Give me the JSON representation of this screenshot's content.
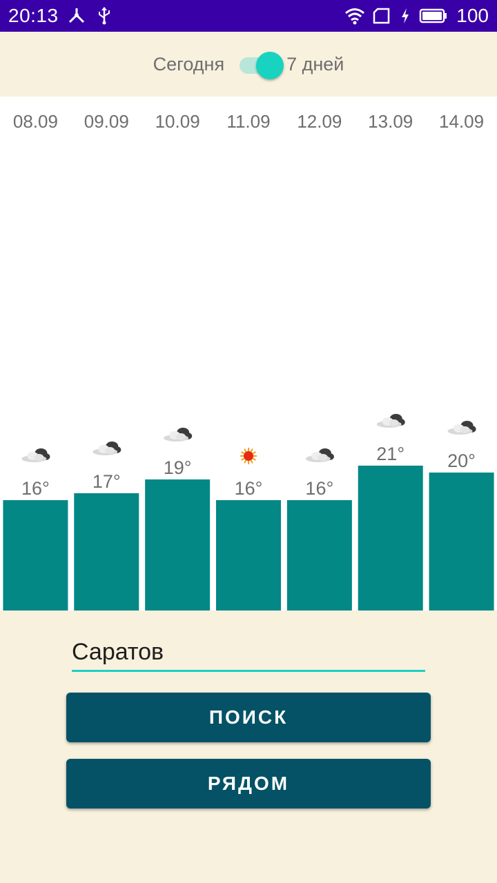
{
  "status_bar": {
    "time": "20:13",
    "battery": "100",
    "icons": [
      "network-share-icon",
      "usb-icon",
      "wifi-icon",
      "sim-card-icon",
      "charging-icon",
      "battery-icon"
    ]
  },
  "toggle": {
    "left_label": "Сегодня",
    "right_label": "7 дней",
    "state": "7 дней",
    "accent_color": "#18d3c0"
  },
  "chart_data": {
    "type": "bar",
    "categories": [
      "08.09",
      "09.09",
      "10.09",
      "11.09",
      "12.09",
      "13.09",
      "14.09"
    ],
    "values": [
      16,
      17,
      19,
      16,
      16,
      21,
      20
    ],
    "value_labels": [
      "16°",
      "17°",
      "19°",
      "16°",
      "16°",
      "21°",
      "20°"
    ],
    "weather_icons": [
      "cloud-icon",
      "cloud-icon",
      "cloud-icon",
      "sun-icon",
      "cloud-icon",
      "cloud-icon",
      "cloud-icon"
    ],
    "bar_color": "#038886",
    "grid": false,
    "legend": "none"
  },
  "search": {
    "value": "Саратов",
    "underline_color": "#1dcfc4"
  },
  "buttons": {
    "search_label": "ПОИСК",
    "nearby_label": "РЯДОМ",
    "color": "#055266"
  }
}
